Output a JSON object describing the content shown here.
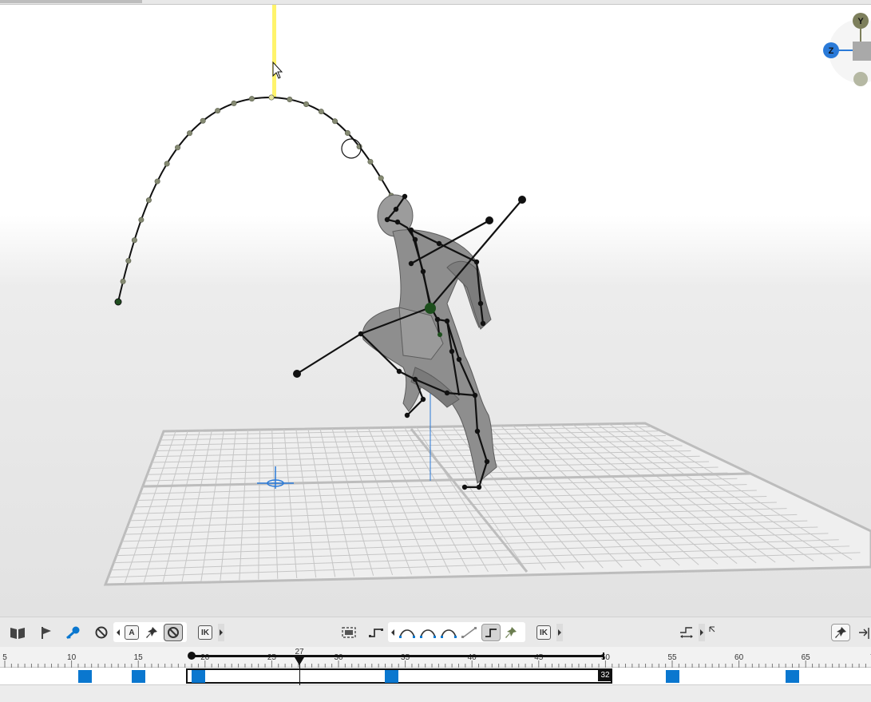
{
  "axis_gizmo": {
    "y_label": "Y",
    "z_label": "Z",
    "colors": {
      "y": "#7d7f5c",
      "z": "#2a7ad8",
      "x": "#b5b8a3"
    }
  },
  "viewport": {
    "trajectory_color": "#111111",
    "joint_color": "#111111",
    "grid_color": "#c2c2c2",
    "ground_marker_color": "#2a7ad8",
    "motion_highlight_color": "#fff36b"
  },
  "toolbar": {
    "icons": [
      "book-icon",
      "flag-icon",
      "key-icon",
      "no-entry-icon",
      "a-filter-icon",
      "pin-icon",
      "no-entry-selected-icon",
      "ik-icon",
      "frame-all-icon",
      "step-curve-icon",
      "curve-ease-in-out-icon",
      "curve-ease-in-icon",
      "curve-ease-out-icon",
      "curve-linear-icon",
      "curve-step-selected-icon",
      "pin-green-icon",
      "ik-icon-2",
      "graph-icon",
      "pin-right-icon",
      "arrow-right-icon"
    ],
    "a_label": "A",
    "ik_label": "IK",
    "ik_label_2": "IK"
  },
  "timeline": {
    "ticks": [
      {
        "label": "5",
        "frame": 5
      },
      {
        "label": "10",
        "frame": 10
      },
      {
        "label": "15",
        "frame": 15
      },
      {
        "label": "20",
        "frame": 20
      },
      {
        "label": "25",
        "frame": 25
      },
      {
        "label": "30",
        "frame": 30
      },
      {
        "label": "35",
        "frame": 35
      },
      {
        "label": "40",
        "frame": 40
      },
      {
        "label": "45",
        "frame": 45
      },
      {
        "label": "50",
        "frame": 50
      },
      {
        "label": "55",
        "frame": 55
      },
      {
        "label": "60",
        "frame": 60
      },
      {
        "label": "65",
        "frame": 65
      },
      {
        "label": "7",
        "frame": 70
      }
    ],
    "current_frame": "27",
    "range_end_label": "32",
    "keyframes": [
      11,
      15,
      19.5,
      34,
      55,
      64
    ],
    "key_color": "#0a77cf"
  }
}
